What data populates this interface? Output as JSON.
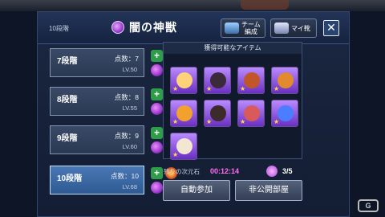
{
  "header": {
    "tier_tag": "10段階",
    "title": "闇の神獣",
    "team_button_label": "チーム\n編成",
    "shoes_button_label": "マイ靴",
    "close_label": "✕"
  },
  "tiers": [
    {
      "name": "7段階",
      "points": "点数：7",
      "level": "LV.50",
      "selected": false
    },
    {
      "name": "8段階",
      "points": "点数：8",
      "level": "LV.55",
      "selected": false
    },
    {
      "name": "9段階",
      "points": "点数：9",
      "level": "LV.60",
      "selected": false
    },
    {
      "name": "10段階",
      "points": "点数：10",
      "level": "LV.68",
      "selected": true
    }
  ],
  "rewards": {
    "heading": "獲得可能なアイテム",
    "items": [
      {
        "icon": "character-icon",
        "color": "#ffd27a"
      },
      {
        "icon": "dark-armor-icon",
        "color": "#3a2a3a"
      },
      {
        "icon": "staff-icon",
        "color": "#c0562a"
      },
      {
        "icon": "axe-icon",
        "color": "#e28a2f"
      },
      {
        "icon": "food-bowl-icon",
        "color": "#f2a12e"
      },
      {
        "icon": "dark-gauntlet-icon",
        "color": "#3d2b2b"
      },
      {
        "icon": "meat-icon",
        "color": "#d85a5a"
      },
      {
        "icon": "blue-flame-icon",
        "color": "#4a7dff"
      },
      {
        "icon": "pet-icon",
        "color": "#f4e7d2"
      }
    ]
  },
  "status": {
    "time_label": "残りの次元石",
    "time_value": "00:12:14",
    "count": "3/5"
  },
  "buttons": {
    "auto_join": "自動参加",
    "private_room": "非公開部屋"
  },
  "watermark": "G"
}
